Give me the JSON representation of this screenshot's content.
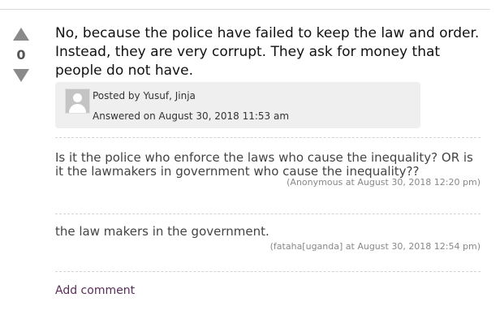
{
  "answer": {
    "vote_count": "0",
    "text": "No, because the police have failed to keep the law and order. Instead, they are very corrupt. They ask for money that people do not have.",
    "posted_by": "Posted by Yusuf, Jinja",
    "answered_on": "Answered on August 30, 2018 11:53 am"
  },
  "comments": [
    {
      "text": "Is it the police who enforce the laws who cause the inequality? OR is it the lawmakers in government who cause the inequality??",
      "meta": "(Anonymous at August 30, 2018 12:20 pm)"
    },
    {
      "text": "the law makers in the government.",
      "meta": "(fataha[uganda] at August 30, 2018 12:54 pm)"
    }
  ],
  "add_comment_label": "Add comment",
  "icons": {
    "upvote": "triangle-up",
    "downvote": "triangle-down",
    "avatar": "default-user-silhouette"
  },
  "colors": {
    "link": "#5a2d5a",
    "meta_box_bg": "#efefef",
    "vote_arrow": "#8a8a8a"
  }
}
